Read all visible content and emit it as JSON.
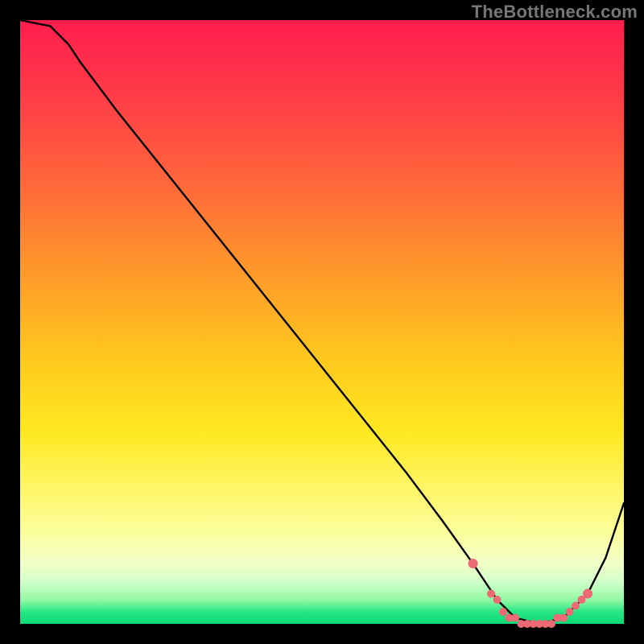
{
  "watermark": "TheBottleneck.com",
  "chart_data": {
    "type": "line",
    "title": "",
    "xlabel": "",
    "ylabel": "",
    "xlim": [
      0,
      100
    ],
    "ylim": [
      0,
      100
    ],
    "background_gradient": {
      "top_color": "#ff1d4e",
      "mid_color": "#ffe820",
      "bottom_color": "#0cd776",
      "meaning": "red = high bottleneck, green = low bottleneck"
    },
    "series": [
      {
        "name": "bottleneck-curve",
        "color": "#000000",
        "x": [
          0,
          5,
          8,
          10,
          16,
          24,
          32,
          40,
          48,
          56,
          64,
          70,
          75,
          79,
          82,
          86,
          90,
          94,
          97,
          100
        ],
        "values": [
          100,
          99,
          96,
          93,
          85,
          75,
          65,
          55,
          45,
          35,
          25,
          17,
          10,
          4,
          1,
          0,
          1,
          5,
          11,
          20
        ]
      },
      {
        "name": "highlight-markers",
        "color": "#ed6a74",
        "x": [
          75,
          78,
          79,
          80,
          81,
          82,
          83,
          84,
          85,
          86,
          87,
          88,
          89,
          90,
          91,
          92,
          93,
          94
        ],
        "values": [
          10,
          5,
          4,
          2,
          1,
          1,
          0,
          0,
          0,
          0,
          0,
          0,
          1,
          1,
          2,
          3,
          4,
          5
        ]
      }
    ]
  }
}
